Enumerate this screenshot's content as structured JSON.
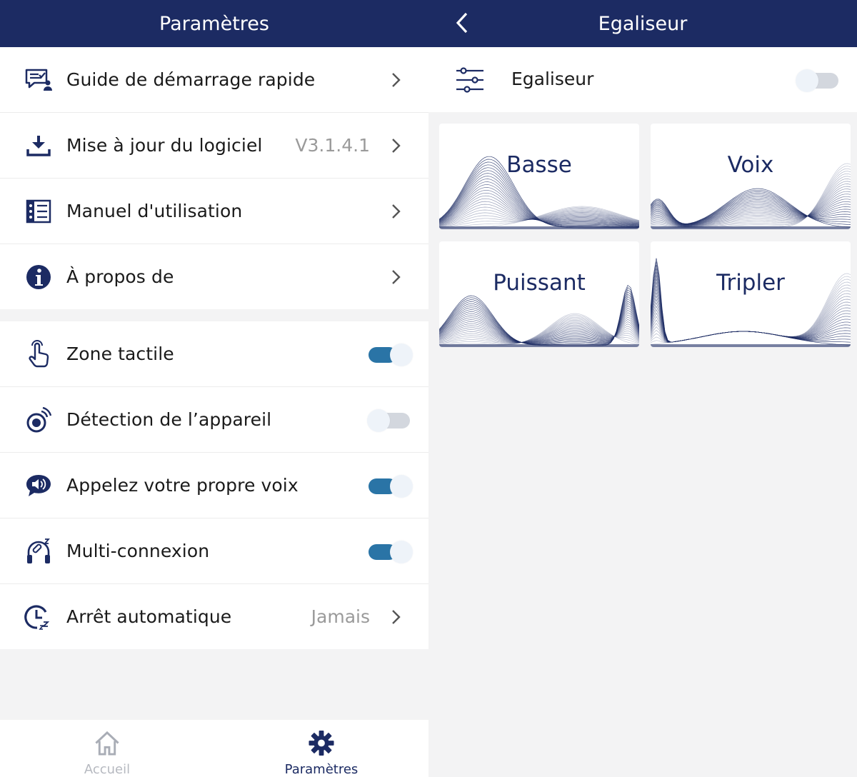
{
  "left": {
    "header_title": "Paramètres",
    "menu": [
      {
        "label": "Guide de démarrage rapide",
        "icon": "chat-guide-icon"
      },
      {
        "label": "Mise à jour du logiciel",
        "value": "V3.1.4.1",
        "icon": "download-icon"
      },
      {
        "label": "Manuel d'utilisation",
        "icon": "manual-icon"
      },
      {
        "label": "À propos de",
        "icon": "info-icon"
      }
    ],
    "settings": [
      {
        "label": "Zone tactile",
        "icon": "touch-icon",
        "toggle": "on"
      },
      {
        "label": "Détection de l’appareil",
        "icon": "detection-icon",
        "toggle": "off"
      },
      {
        "label": "Appelez votre propre voix",
        "icon": "speaker-voice-icon",
        "toggle": "on"
      },
      {
        "label": "Multi-connexion",
        "icon": "headphones-link-icon",
        "toggle": "on"
      },
      {
        "label": "Arrêt automatique",
        "value": "Jamais",
        "icon": "auto-off-icon"
      }
    ],
    "nav": [
      {
        "label": "Accueil",
        "icon": "home-icon",
        "active": false
      },
      {
        "label": "Paramètres",
        "icon": "gear-icon",
        "active": true
      }
    ]
  },
  "right": {
    "header_title": "Egaliseur",
    "eq_label": "Egaliseur",
    "eq_toggle": "off",
    "presets": [
      "Basse",
      "Voix",
      "Puissant",
      "Tripler"
    ]
  },
  "colors": {
    "header_bg": "#1c2b63",
    "accent_toggle": "#2a74a6",
    "wave": "#1c2b63",
    "muted_text": "#9a9a9a"
  }
}
